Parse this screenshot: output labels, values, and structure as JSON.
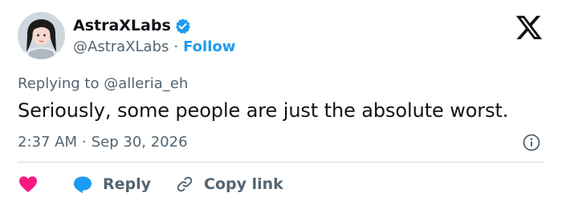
{
  "author": {
    "display_name": "AstraXLabs",
    "handle": "@AstraXLabs",
    "separator": "·",
    "follow_label": "Follow",
    "verified": true
  },
  "reply_context": {
    "prefix": "Replying to",
    "mention": "@alleria_eh"
  },
  "tweet": {
    "text": "Seriously, some people are just the absolute worst.",
    "time": "2:37 AM",
    "separator": "·",
    "date": "Sep 30, 2026"
  },
  "actions": {
    "reply_label": "Reply",
    "copy_link_label": "Copy link"
  },
  "colors": {
    "accent": "#1d9bf0",
    "like": "#f91880",
    "muted": "#536471",
    "text": "#0f1419"
  },
  "icons": [
    "verified-badge-icon",
    "x-logo-icon",
    "info-icon",
    "heart-icon",
    "speech-bubble-icon",
    "link-icon"
  ]
}
